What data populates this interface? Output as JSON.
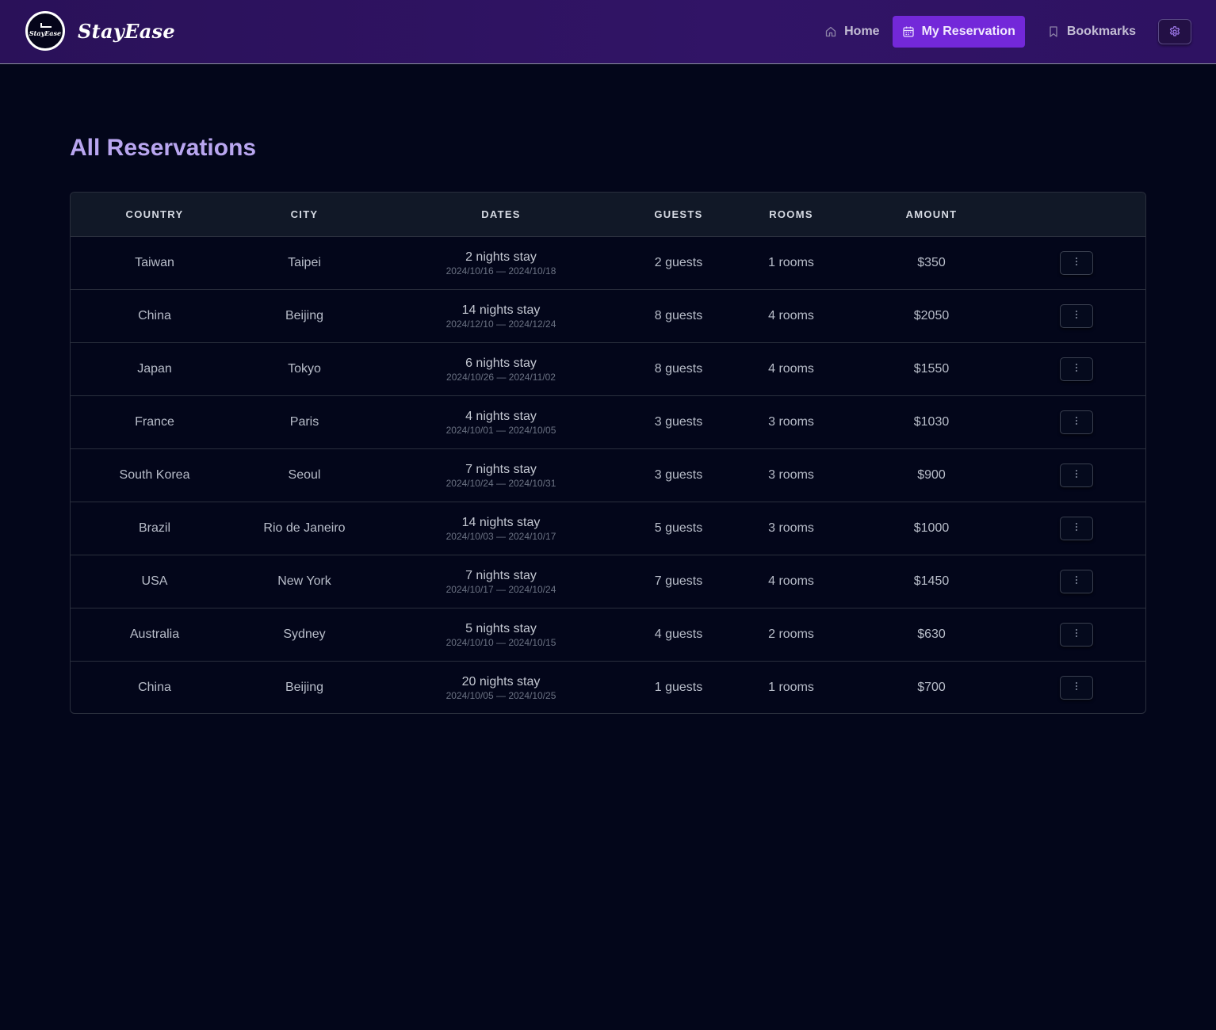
{
  "brand": {
    "name": "StayEase",
    "logo_text": "StayEase"
  },
  "nav": {
    "home": "Home",
    "reservation": "My Reservation",
    "bookmarks": "Bookmarks"
  },
  "page": {
    "title": "All Reservations"
  },
  "table": {
    "headers": [
      "COUNTRY",
      "CITY",
      "DATES",
      "GUESTS",
      "ROOMS",
      "AMOUNT"
    ],
    "rows": [
      {
        "country": "Taiwan",
        "city": "Taipei",
        "stay": "2 nights stay",
        "range": "2024/10/16 — 2024/10/18",
        "guests": "2 guests",
        "rooms": "1 rooms",
        "amount": "$350"
      },
      {
        "country": "China",
        "city": "Beijing",
        "stay": "14 nights stay",
        "range": "2024/12/10 — 2024/12/24",
        "guests": "8 guests",
        "rooms": "4 rooms",
        "amount": "$2050"
      },
      {
        "country": "Japan",
        "city": "Tokyo",
        "stay": "6 nights stay",
        "range": "2024/10/26 — 2024/11/02",
        "guests": "8 guests",
        "rooms": "4 rooms",
        "amount": "$1550"
      },
      {
        "country": "France",
        "city": "Paris",
        "stay": "4 nights stay",
        "range": "2024/10/01 — 2024/10/05",
        "guests": "3 guests",
        "rooms": "3 rooms",
        "amount": "$1030"
      },
      {
        "country": "South Korea",
        "city": "Seoul",
        "stay": "7 nights stay",
        "range": "2024/10/24 — 2024/10/31",
        "guests": "3 guests",
        "rooms": "3 rooms",
        "amount": "$900"
      },
      {
        "country": "Brazil",
        "city": "Rio de Janeiro",
        "stay": "14 nights stay",
        "range": "2024/10/03 — 2024/10/17",
        "guests": "5 guests",
        "rooms": "3 rooms",
        "amount": "$1000"
      },
      {
        "country": "USA",
        "city": "New York",
        "stay": "7 nights stay",
        "range": "2024/10/17 — 2024/10/24",
        "guests": "7 guests",
        "rooms": "4 rooms",
        "amount": "$1450"
      },
      {
        "country": "Australia",
        "city": "Sydney",
        "stay": "5 nights stay",
        "range": "2024/10/10 — 2024/10/15",
        "guests": "4 guests",
        "rooms": "2 rooms",
        "amount": "$630"
      },
      {
        "country": "China",
        "city": "Beijing",
        "stay": "20 nights stay",
        "range": "2024/10/05 — 2024/10/25",
        "guests": "1 guests",
        "rooms": "1 rooms",
        "amount": "$700"
      }
    ]
  },
  "icons": {
    "home": "home-icon",
    "reservation": "calendar-icon",
    "bookmarks": "bookmark-icon",
    "settings": "gear-icon",
    "row_menu": "more-vertical-icon"
  },
  "colors": {
    "header_bg": "#2d1260",
    "accent": "#7328d9",
    "title": "#b9a6f0",
    "page_bg": "#03061a"
  }
}
